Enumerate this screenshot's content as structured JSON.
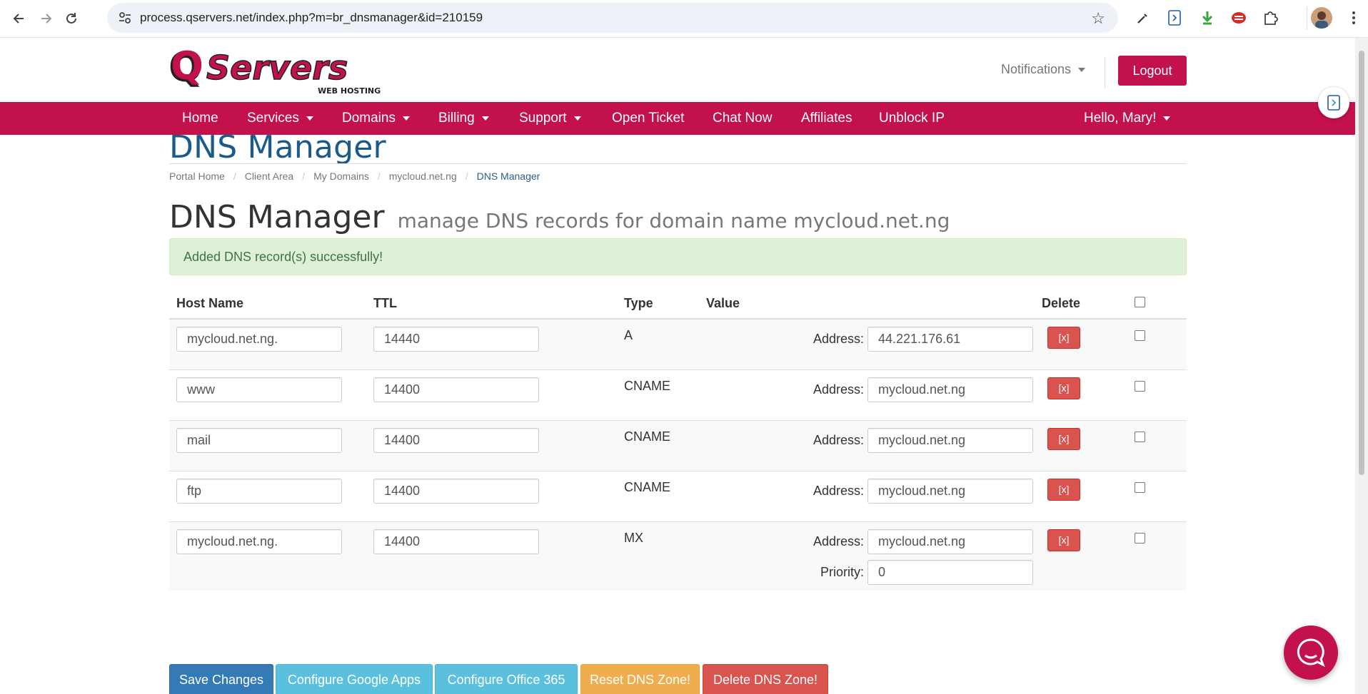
{
  "browser": {
    "url": "process.qservers.net/index.php?m=br_dnsmanager&id=210159",
    "back_icon": "arrow-left-icon",
    "forward_icon": "arrow-right-icon",
    "reload_icon": "reload-icon",
    "extensions": [
      "eyedropper-icon",
      "extension-docs-icon",
      "download-arrow-icon",
      "lastpass-icon",
      "puzzle-icon",
      "profile-avatar"
    ]
  },
  "header": {
    "logo_text": "QServers",
    "logo_subtext": "WEB HOSTING",
    "notifications_label": "Notifications",
    "logout_label": "Logout"
  },
  "menu": {
    "items": [
      {
        "label": "Home",
        "dropdown": false
      },
      {
        "label": "Services",
        "dropdown": true
      },
      {
        "label": "Domains",
        "dropdown": true
      },
      {
        "label": "Billing",
        "dropdown": true
      },
      {
        "label": "Support",
        "dropdown": true
      },
      {
        "label": "Open Ticket",
        "dropdown": false
      },
      {
        "label": "Chat Now",
        "dropdown": false
      },
      {
        "label": "Affiliates",
        "dropdown": false
      },
      {
        "label": "Unblock IP",
        "dropdown": false
      }
    ],
    "greeting": "Hello, Mary!"
  },
  "page": {
    "title": "DNS Manager",
    "breadcrumb": [
      "Portal Home",
      "Client Area",
      "My Domains",
      "mycloud.net.ng",
      "DNS Manager"
    ],
    "heading": "DNS Manager",
    "subheading": "manage DNS records for domain name mycloud.net.ng",
    "alert": "Added DNS record(s) successfully!"
  },
  "table": {
    "headers": {
      "host": "Host Name",
      "ttl": "TTL",
      "type": "Type",
      "value": "Value",
      "delete": "Delete"
    },
    "address_label": "Address:",
    "priority_label": "Priority:",
    "delete_label": "[x]",
    "rows": [
      {
        "host": "mycloud.net.ng.",
        "ttl": "14440",
        "type": "A",
        "address": "44.221.176.61"
      },
      {
        "host": "www",
        "ttl": "14400",
        "type": "CNAME",
        "address": "mycloud.net.ng"
      },
      {
        "host": "mail",
        "ttl": "14400",
        "type": "CNAME",
        "address": "mycloud.net.ng"
      },
      {
        "host": "ftp",
        "ttl": "14400",
        "type": "CNAME",
        "address": "mycloud.net.ng"
      },
      {
        "host": "mycloud.net.ng.",
        "ttl": "14400",
        "type": "MX",
        "address": "mycloud.net.ng",
        "priority": "0"
      }
    ]
  },
  "buttons": {
    "save": "Save Changes",
    "google": "Configure Google Apps",
    "office": "Configure Office 365",
    "reset": "Reset DNS Zone!",
    "delete_zone": "Delete DNS Zone!"
  },
  "colors": {
    "brand": "#c2114b",
    "title_blue": "#1b5b8b",
    "primary": "#337ab7",
    "info": "#5bc0de",
    "warning": "#f0ad4e",
    "danger": "#d9534f"
  }
}
